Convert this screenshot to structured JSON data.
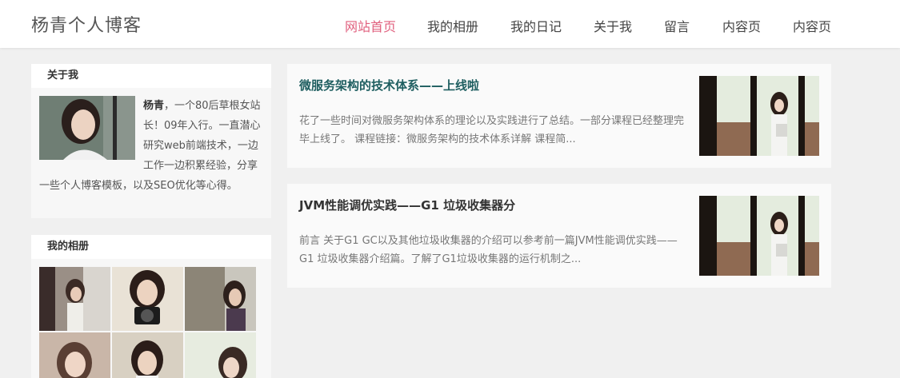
{
  "site": {
    "logo": "杨青个人博客"
  },
  "nav": [
    {
      "label": "网站首页",
      "active": true
    },
    {
      "label": "我的相册",
      "active": false
    },
    {
      "label": "我的日记",
      "active": false
    },
    {
      "label": "关于我",
      "active": false
    },
    {
      "label": "留言",
      "active": false
    },
    {
      "label": "内容页",
      "active": false
    },
    {
      "label": "内容页",
      "active": false
    }
  ],
  "about": {
    "title": "关于我",
    "name": "杨青",
    "text": "，一个80后草根女站长！09年入行。一直潜心研究web前端技术，一边工作一边积累经验，分享一些个人博客模板，以及SEO优化等心得。"
  },
  "album": {
    "title": "我的相册"
  },
  "articles": [
    {
      "title": "微服务架构的技术体系——上线啦",
      "desc": "花了一些时间对微服务架构体系的理论以及实践进行了总结。一部分课程已经整理完毕上线了。 课程链接：微服务架构的技术体系详解 课程简..."
    },
    {
      "title": "JVM性能调优实践——G1 垃圾收集器分",
      "desc": "前言 关于G1 GC以及其他垃圾收集器的介绍可以参考前一篇JVM性能调优实践——G1 垃圾收集器介绍篇。了解了G1垃圾收集器的运行机制之..."
    }
  ],
  "colors": {
    "accent": "#e0607e",
    "title_teal": "#1e5e60"
  }
}
